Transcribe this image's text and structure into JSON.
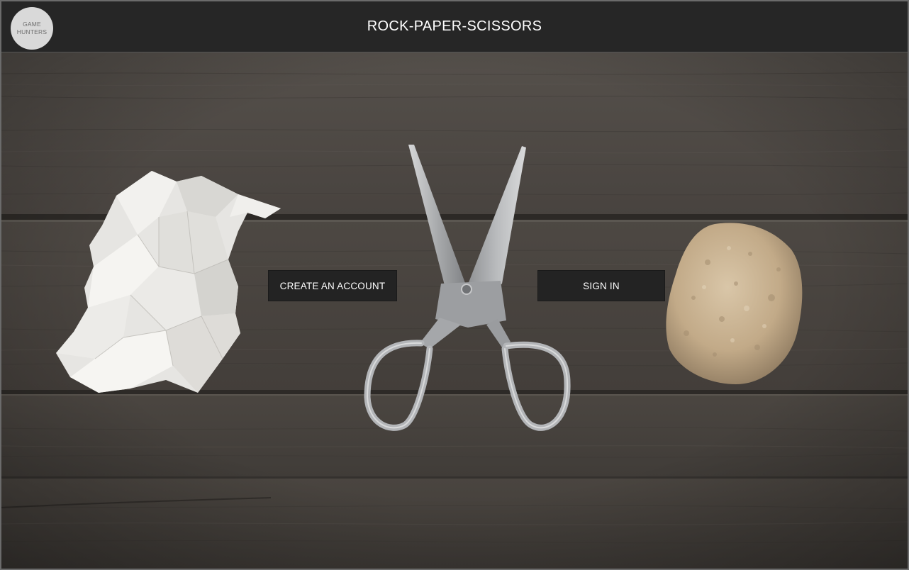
{
  "header": {
    "logo_line1": "GAME",
    "logo_line2": "HUNTERS",
    "title": "ROCK-PAPER-SCISSORS"
  },
  "actions": {
    "create_account_label": "CREATE AN ACCOUNT",
    "sign_in_label": "SIGN IN"
  },
  "colors": {
    "header_bg": "#262626",
    "button_bg": "#232323",
    "wood": "#4d4845"
  },
  "icons": {
    "paper": "crumpled-paper-image",
    "scissors": "scissors-image",
    "rock": "rock-image"
  }
}
